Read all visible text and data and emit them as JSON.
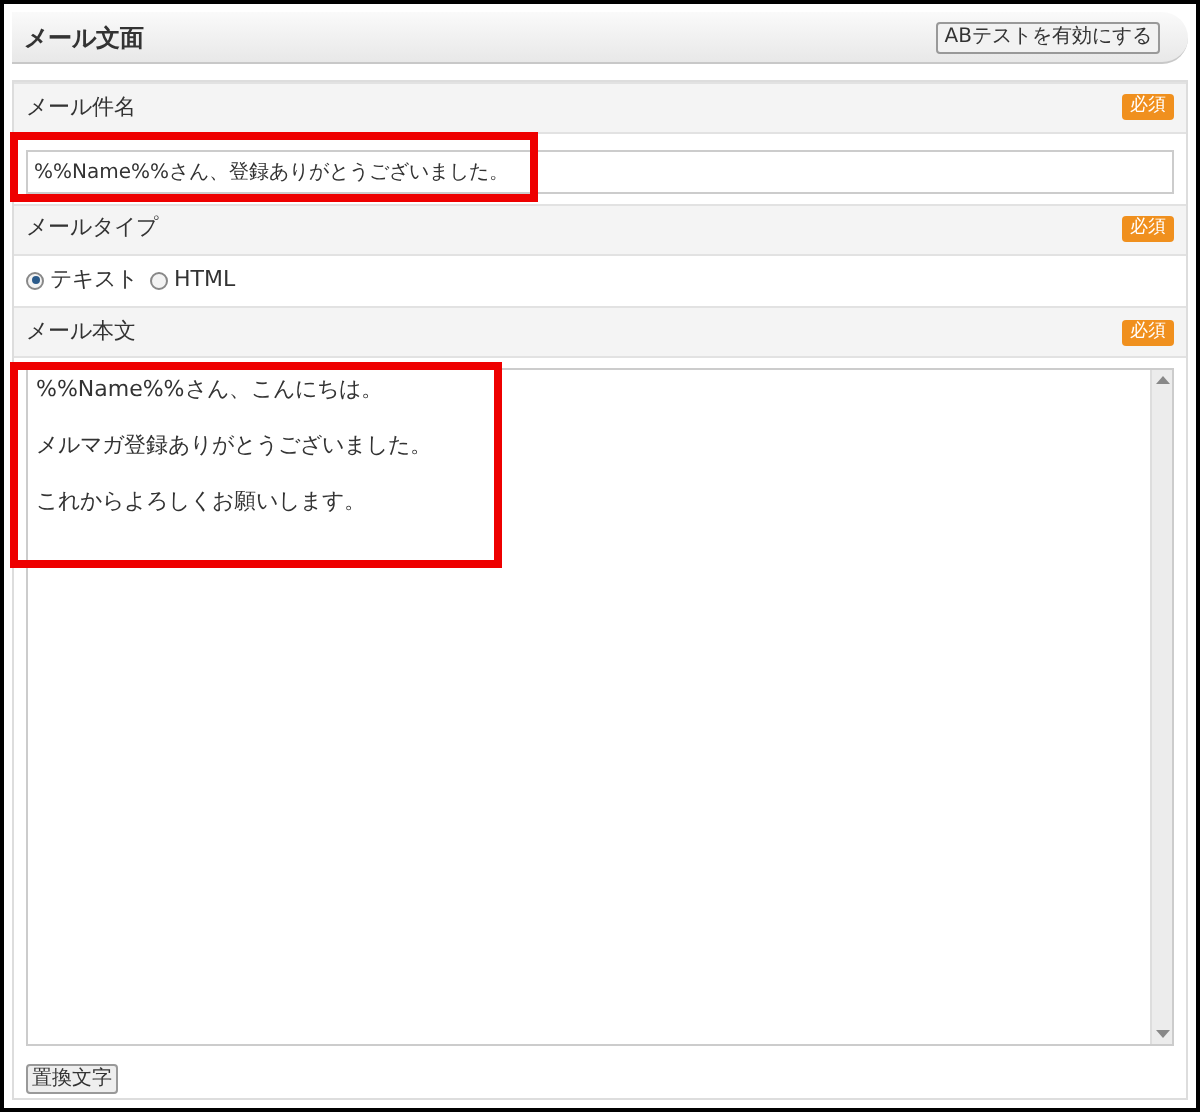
{
  "header": {
    "title": "メール文面",
    "ab_button": "ABテストを有効にする"
  },
  "subject": {
    "label": "メール件名",
    "required": "必須",
    "value": "%%Name%%さん、登録ありがとうございました。",
    "highlighted": true
  },
  "mail_type": {
    "label": "メールタイプ",
    "required": "必須",
    "options": [
      {
        "label": "テキスト",
        "selected": true
      },
      {
        "label": "HTML",
        "selected": false
      }
    ]
  },
  "body": {
    "label": "メール本文",
    "required": "必須",
    "lines": [
      "%%Name%%さん、こんにちは。",
      "メルマガ登録ありがとうございました。",
      "これからよろしくお願いします。"
    ],
    "highlighted": true
  },
  "replace_button": "置換文字"
}
